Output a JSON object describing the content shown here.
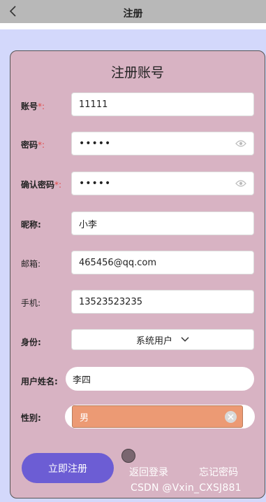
{
  "nav": {
    "title": "注册"
  },
  "form": {
    "heading": "注册账号",
    "account": {
      "label": "账号",
      "required_mark": "*:",
      "value": "11111"
    },
    "password": {
      "label": "密码",
      "required_mark": "*:",
      "value": "•••••"
    },
    "confirm_password": {
      "label": "确认密码",
      "required_mark": "*:",
      "value": "•••••"
    },
    "nickname": {
      "label": "昵称:",
      "value": "小李"
    },
    "email": {
      "label": "邮箱:",
      "value": "465456@qq.com"
    },
    "phone": {
      "label": "手机:",
      "value": "13523523235"
    },
    "identity": {
      "label": "身份:",
      "value": "系统用户"
    },
    "real_name": {
      "label": "用户姓名:",
      "value": "李四"
    },
    "gender": {
      "label": "性别:",
      "value": "男"
    }
  },
  "actions": {
    "register": "立即注册",
    "back_to_login": "返回登录",
    "forgot_password": "忘记密码"
  },
  "watermark": "CSDN @Vxin_CXSJ881",
  "colors": {
    "card": "#d8b3c3",
    "primary_button": "#6c5dd4",
    "gender_chip": "#ec9a74",
    "required": "#e04848"
  }
}
